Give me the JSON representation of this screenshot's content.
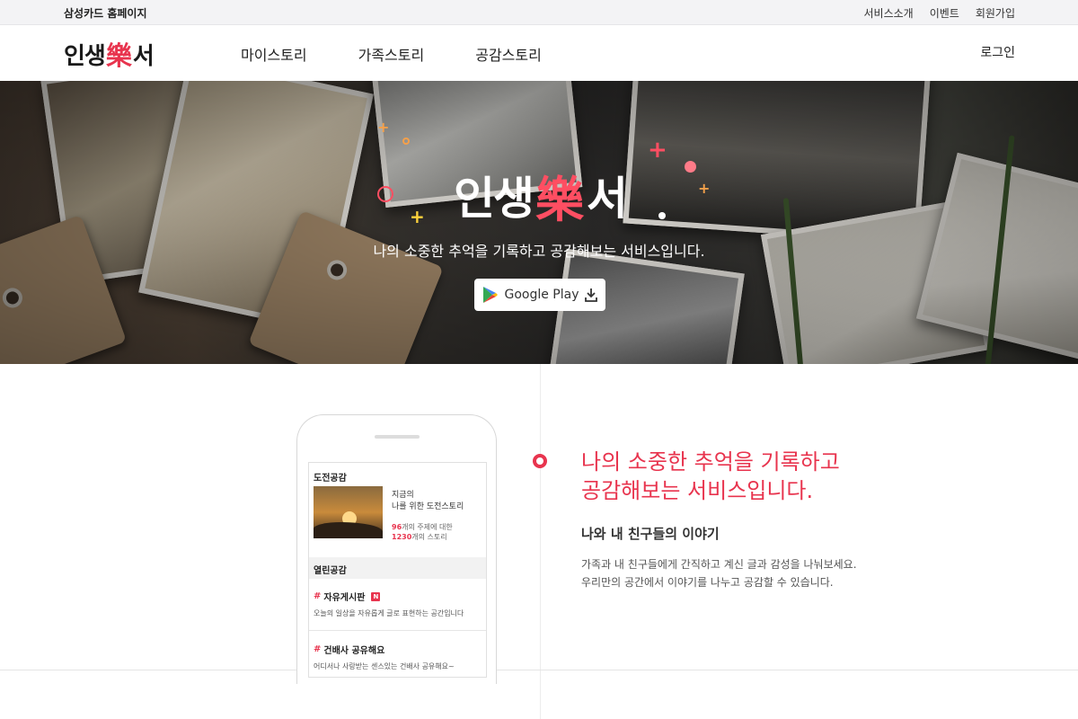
{
  "topbar": {
    "home_link": "삼성카드 홈페이지",
    "links": [
      "서비스소개",
      "이벤트",
      "회원가입"
    ]
  },
  "header": {
    "logo": {
      "part1": "인생",
      "part2": "樂",
      "part3": "서"
    },
    "nav": [
      "마이스토리",
      "가족스토리",
      "공감스토리"
    ],
    "login": "로그인"
  },
  "hero": {
    "logo": {
      "part1": "인생",
      "part2": "樂",
      "part3": "서"
    },
    "subtitle": "나의 소중한 추억을 기록하고 공감해보는 서비스입니다.",
    "store_button": "Google Play"
  },
  "phone_screen": {
    "section1_title": "도전공감",
    "story_line1": "지금의",
    "story_line2": "나를 위한 도전스토리",
    "topic_count": "96",
    "topic_suffix": "개의 주제에 대한",
    "story_count": "1230",
    "story_suffix": "개의 스토리",
    "section2_title": "열린공감",
    "items": [
      {
        "hash": "#",
        "title": "자유게시판",
        "badge": "N",
        "desc": "오늘의 일상을 자유롭게 글로 표현하는 공간입니다"
      },
      {
        "hash": "#",
        "title": "건배사 공유해요",
        "desc": "어디서나 사랑받는 센스있는 건배사 공유해요~"
      }
    ]
  },
  "feature": {
    "headline_line1": "나의 소중한 추억을 기록하고",
    "headline_line2": "공감해보는 서비스입니다.",
    "subhead": "나와 내 친구들의 이야기",
    "desc_line1": "가족과 내 친구들에게 간직하고 계신 글과 감성을 나눠보세요.",
    "desc_line2": "우리만의 공간에서 이야기를 나누고 공감할 수 있습니다."
  },
  "colors": {
    "accent": "#e8344e",
    "hero_accent": "#ff4e62",
    "spark_orange": "#f5a04a",
    "spark_yellow": "#ffd23c"
  }
}
